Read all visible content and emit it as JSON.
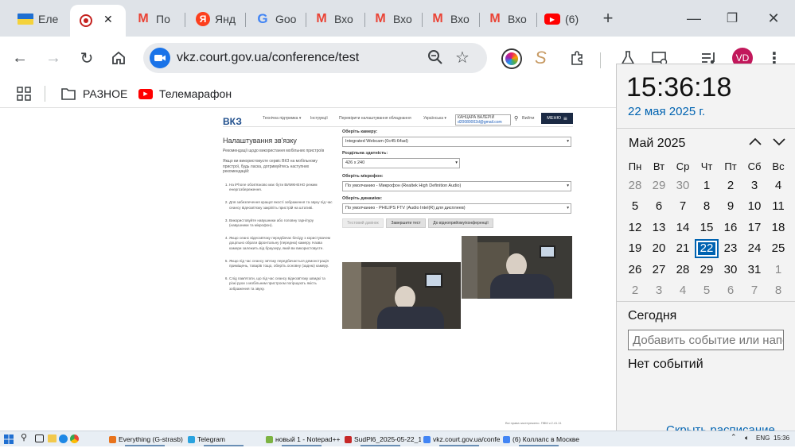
{
  "tabs": [
    {
      "label": "Еле",
      "icon": "ukraine-flag-icon",
      "active": false
    },
    {
      "label": "",
      "icon": "record-icon",
      "active": true
    },
    {
      "label": "По",
      "icon": "gmail-icon",
      "active": false
    },
    {
      "label": "Янд",
      "icon": "yandex-icon",
      "active": false
    },
    {
      "label": "Goo",
      "icon": "google-icon",
      "active": false
    },
    {
      "label": "Вхо",
      "icon": "gmail-icon",
      "active": false
    },
    {
      "label": "Вхо",
      "icon": "gmail-icon",
      "active": false
    },
    {
      "label": "Вхо",
      "icon": "gmail-icon",
      "active": false
    },
    {
      "label": "Вхо",
      "icon": "gmail-icon",
      "active": false
    },
    {
      "label": "(6)",
      "icon": "youtube-icon",
      "active": false
    }
  ],
  "tab_close_glyph": "✕",
  "new_tab_glyph": "+",
  "window_controls": {
    "minimize": "—",
    "maximize": "❐",
    "close": "✕"
  },
  "toolbar": {
    "url": "vkz.court.gov.ua/conference/test",
    "profile_initials": "VD"
  },
  "bookmarks": [
    {
      "label": "РАЗНОЕ",
      "icon": "folder-icon"
    },
    {
      "label": "Телемарафон",
      "icon": "youtube-icon"
    }
  ],
  "vkz": {
    "logo": "ВКЗ",
    "nav": [
      "Технічна підтримка ▾",
      "Інструкції",
      "Перевірити налаштування обладнання",
      "Українська ▾"
    ],
    "user_name": "КАНЦАРА ВАЛЕРІЙ",
    "user_email": "d20080002d@gmail.com",
    "logout": "Вийти",
    "menu": "МЕНЮ",
    "title": "Налаштування зв'язку",
    "mobile_heading": "Рекомендації щодо використання мобільних пристроїв",
    "intro": "Якщо ви використовуєте сервіс ВКЗ на мобільному пристрої, будь ласка, дотримуйтесь наступних рекомендацій:",
    "recommendations": [
      "На iPhone обов'язково має бути ВИМКНЕНО режим енергозбереження.",
      "Для забезпечення кращої якості зображення та звуку під час сеансу відеозв'язку закріпіть пристрій на штативі.",
      "Використовуйте навушники або головну гарнітуру (навушники та мікрофон).",
      "Якщо сеанс відеозв'язку передбачає бесіду з користувачем доцільно обрати фронтальну (передню) камеру. Назва камери залежить від браузеру, який ви використовуєте.",
      "Якщо під час сеансу зв'язку передбачається демонстрація приміщень, товарів тощо, оберіть основну (задню) камеру.",
      "Слід пам'ятати, що під час сеансу відеозв'язку швидкі та різкі рухи з мобільним пристроєм погіршують якість зображення та звуку."
    ],
    "camera_label": "Оберіть камеру:",
    "camera_value": "Integrated Webcam (0c45:64ad)",
    "resolution_label": "Роздільна здатність:",
    "resolution_value": "426 x 240",
    "mic_label": "Оберіть мікрофон:",
    "mic_value": "По умолчанию - Микрофон (Realtek High Definition Audio)",
    "speaker_label": "Оберіть динаміки:",
    "speaker_value": "По умолчанию - PHILIPS FTV (Audio Intel(R) для дисплеев)",
    "buttons": [
      "Тестовий дзвінок",
      "Завершити тест",
      "До відеоприйому/конференції"
    ],
    "footer": "Всі права застережено. ПВМ v.2.41.11"
  },
  "calendar": {
    "time": "15:36:18",
    "date": "22 мая 2025 г.",
    "month": "Май 2025",
    "weekdays": [
      "Пн",
      "Вт",
      "Ср",
      "Чт",
      "Пт",
      "Сб",
      "Вс"
    ],
    "weeks": [
      [
        "28",
        "29",
        "30",
        "1",
        "2",
        "3",
        "4"
      ],
      [
        "5",
        "6",
        "7",
        "8",
        "9",
        "10",
        "11"
      ],
      [
        "12",
        "13",
        "14",
        "15",
        "16",
        "17",
        "18"
      ],
      [
        "19",
        "20",
        "21",
        "22",
        "23",
        "24",
        "25"
      ],
      [
        "26",
        "27",
        "28",
        "29",
        "30",
        "31",
        "1"
      ],
      [
        "2",
        "3",
        "4",
        "5",
        "6",
        "7",
        "8"
      ]
    ],
    "today": "22",
    "today_heading": "Сегодня",
    "add_event_placeholder": "Добавить событие или напо",
    "no_events": "Нет событий",
    "show_schedule": "Скрыть расписание",
    "accent": "#0063b1"
  },
  "taskbar": {
    "items": [
      {
        "label": "Everything (G-strasb)",
        "color": "#e8731c"
      },
      {
        "label": "Telegram",
        "color": "#2aa3df"
      },
      {
        "label": "новый 1 - Notepad++",
        "color": "#7cb342"
      },
      {
        "label": "SudPl6_2025-05-22_1...",
        "color": "#c62828"
      },
      {
        "label": "vkz.court.gov.ua/confe...",
        "color": "#4285f4"
      },
      {
        "label": "(6) Коллапс в Москве ...",
        "color": "#4285f4"
      }
    ],
    "language": "ENG",
    "clock": "15:36"
  }
}
